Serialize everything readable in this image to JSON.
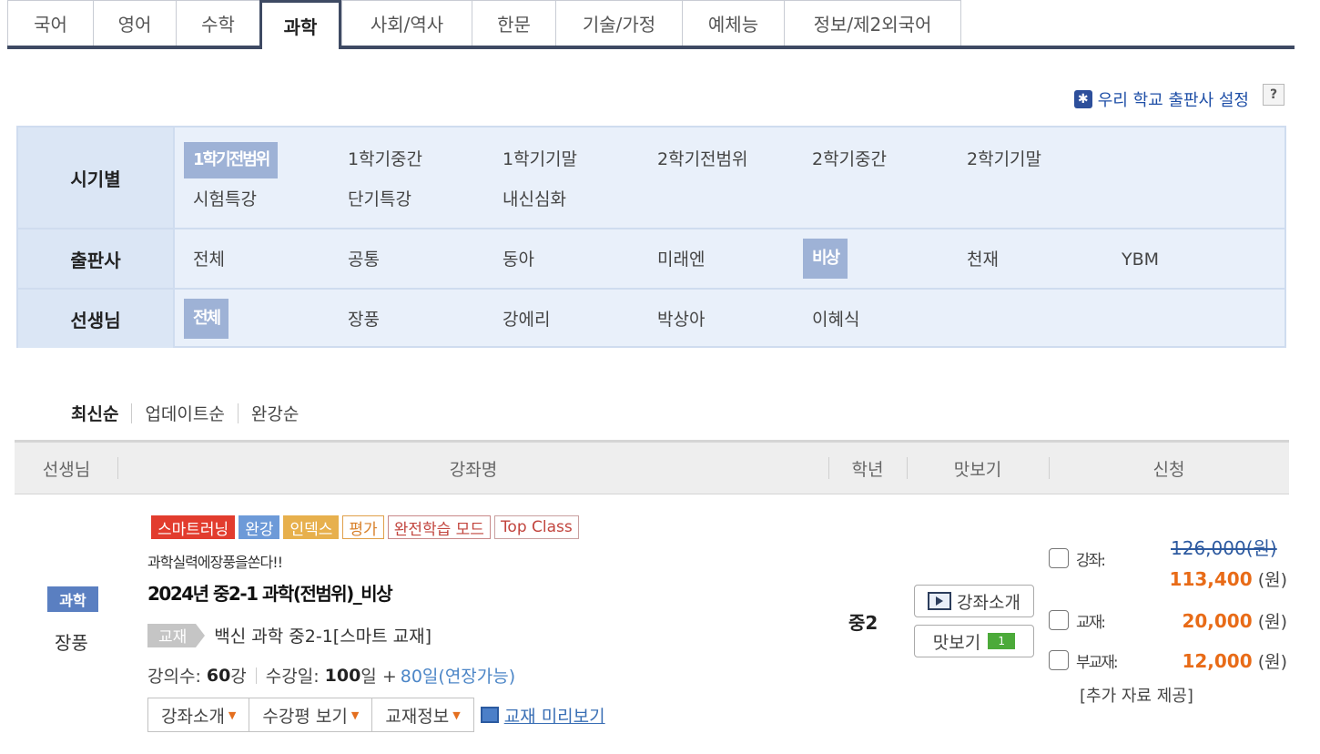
{
  "tabs": [
    {
      "label": "국어",
      "active": false
    },
    {
      "label": "영어",
      "active": false
    },
    {
      "label": "수학",
      "active": false
    },
    {
      "label": "과학",
      "active": true
    },
    {
      "label": "사회/역사",
      "active": false
    },
    {
      "label": "한문",
      "active": false
    },
    {
      "label": "기술/가정",
      "active": false
    },
    {
      "label": "예체능",
      "active": false
    },
    {
      "label": "정보/제2외국어",
      "active": false
    }
  ],
  "publisher_setting": {
    "label": "우리 학교 출판사 설정",
    "help": "?"
  },
  "filters": {
    "period": {
      "label": "시기별",
      "options": [
        "1학기전범위",
        "1학기중간",
        "1학기기말",
        "2학기전범위",
        "2학기중간",
        "2학기기말",
        "시험특강",
        "단기특강",
        "내신심화"
      ],
      "selected": "1학기전범위"
    },
    "publisher": {
      "label": "출판사",
      "options": [
        "전체",
        "공통",
        "동아",
        "미래엔",
        "비상",
        "천재",
        "YBM"
      ],
      "selected": "비상"
    },
    "teacher": {
      "label": "선생님",
      "options": [
        "전체",
        "장풍",
        "강에리",
        "박상아",
        "이혜식"
      ],
      "selected": "전체"
    }
  },
  "sort": {
    "options": [
      "최신순",
      "업데이트순",
      "완강순"
    ],
    "selected": "최신순"
  },
  "table_header": [
    "선생님",
    "강좌명",
    "학년",
    "맛보기",
    "신청"
  ],
  "course": {
    "subject": "과학",
    "teacher": "장풍",
    "tags": [
      "스마트러닝",
      "완강",
      "인덱스",
      "평가",
      "완전학습 모드",
      "Top Class"
    ],
    "slogan": "과학실력에장풍을쏜다!!",
    "title": "2024년 중2-1 과학(전범위)_비상",
    "book_tag": "교재",
    "book_name": "백신 과학 중2-1[스마트 교재]",
    "lecture_count_label": "강의수:",
    "lecture_count": "60",
    "lecture_unit": "강",
    "days_label": "수강일:",
    "days": "100",
    "days_unit": "일 +",
    "extension": "80일(연장가능)",
    "buttons": [
      "강좌소개",
      "수강평 보기",
      "교재정보"
    ],
    "preview_link": "교재 미리보기",
    "grade": "중2",
    "intro_button": "강좌소개",
    "sample_button": "맛보기",
    "sample_count": "1",
    "original_price": "126,000(원)",
    "prices": [
      {
        "label": "강좌:",
        "value": "113,400",
        "unit": "(원)"
      },
      {
        "label": "교재:",
        "value": "20,000",
        "unit": "(원)"
      },
      {
        "label": "부교재:",
        "value": "12,000",
        "unit": "(원)"
      }
    ],
    "extra_note": "[추가 자료 제공]"
  },
  "colors": {
    "accent_navy": "#3e4a63",
    "price_orange": "#e86b17",
    "filter_bg": "#e9f0fa",
    "selected_chip": "#9eb2d6"
  }
}
